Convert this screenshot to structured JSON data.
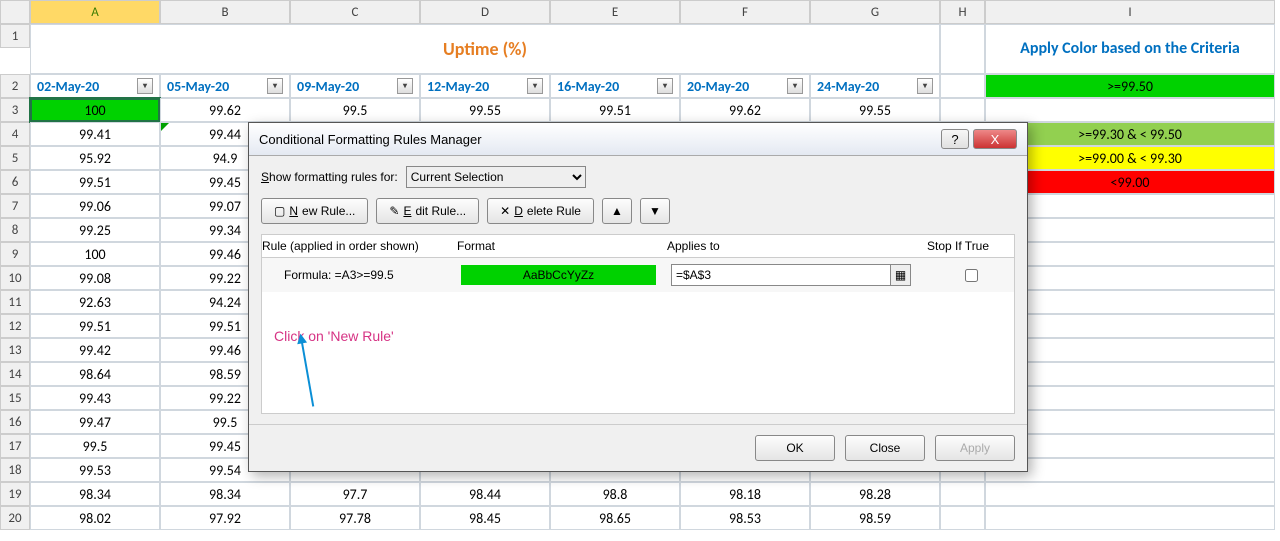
{
  "columns": [
    "A",
    "B",
    "C",
    "D",
    "E",
    "F",
    "G",
    "H",
    "I"
  ],
  "row_numbers": [
    1,
    2,
    3,
    4,
    5,
    6,
    7,
    8,
    9,
    10,
    11,
    12,
    13,
    14,
    15,
    16,
    17,
    18,
    19,
    20
  ],
  "title": "Uptime (%)",
  "criteria_title": "Apply Color based on the Criteria",
  "dates": [
    "02-May-20",
    "05-May-20",
    "09-May-20",
    "12-May-20",
    "16-May-20",
    "20-May-20",
    "24-May-20"
  ],
  "criteria": [
    ">=99.50",
    ">=99.30 & < 99.50",
    ">=99.00 & < 99.30",
    "<99.00"
  ],
  "table": [
    [
      "100",
      "99.62",
      "99.5",
      "99.55",
      "99.51",
      "99.62",
      "99.55"
    ],
    [
      "99.41",
      "99.44",
      "",
      "",
      "",
      "",
      ""
    ],
    [
      "95.92",
      "94.9",
      "",
      "",
      "",
      "",
      ""
    ],
    [
      "99.51",
      "99.45",
      "",
      "",
      "",
      "",
      ""
    ],
    [
      "99.06",
      "99.07",
      "",
      "",
      "",
      "",
      ""
    ],
    [
      "99.25",
      "99.34",
      "",
      "",
      "",
      "",
      ""
    ],
    [
      "100",
      "99.46",
      "",
      "",
      "",
      "",
      ""
    ],
    [
      "99.08",
      "99.22",
      "",
      "",
      "",
      "",
      ""
    ],
    [
      "92.63",
      "94.24",
      "",
      "",
      "",
      "",
      ""
    ],
    [
      "99.51",
      "99.51",
      "",
      "",
      "",
      "",
      ""
    ],
    [
      "99.42",
      "99.46",
      "",
      "",
      "",
      "",
      ""
    ],
    [
      "98.64",
      "98.59",
      "",
      "",
      "",
      "",
      ""
    ],
    [
      "99.43",
      "99.22",
      "",
      "",
      "",
      "",
      ""
    ],
    [
      "99.47",
      "99.5",
      "",
      "",
      "",
      "",
      ""
    ],
    [
      "99.5",
      "99.45",
      "",
      "",
      "",
      "",
      ""
    ],
    [
      "99.53",
      "99.54",
      "",
      "",
      "",
      "",
      ""
    ],
    [
      "98.34",
      "98.34",
      "97.7",
      "98.44",
      "98.8",
      "98.18",
      "98.28"
    ],
    [
      "98.02",
      "97.92",
      "97.78",
      "98.45",
      "98.65",
      "98.53",
      "98.59"
    ]
  ],
  "dialog": {
    "title": "Conditional Formatting Rules Manager",
    "show_label": "Show formatting rules for:",
    "show_value": "Current Selection",
    "buttons": {
      "new_rule": "New Rule...",
      "edit_rule": "Edit Rule...",
      "delete_rule": "Delete Rule"
    },
    "headers": {
      "rule": "Rule (applied in order shown)",
      "format": "Format",
      "applies": "Applies to",
      "stop": "Stop If True"
    },
    "rule": {
      "formula": "Formula: =A3>=99.5",
      "preview": "AaBbCcYyZz",
      "applies_to": "=$A$3"
    },
    "annotation": "Click on 'New Rule'",
    "footer": {
      "ok": "OK",
      "close": "Close",
      "apply": "Apply"
    },
    "help_icon": "?",
    "close_icon": "X"
  }
}
